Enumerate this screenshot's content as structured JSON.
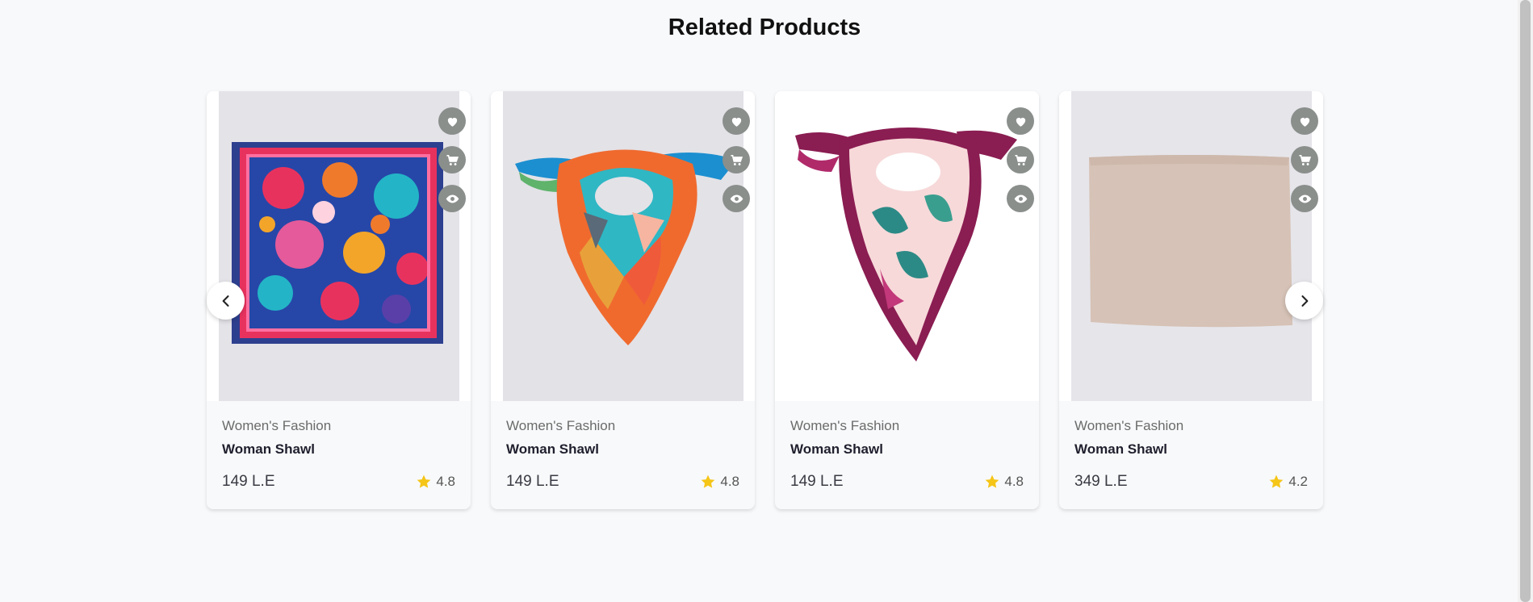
{
  "section": {
    "title": "Related Products"
  },
  "products": [
    {
      "category": "Women's Fashion",
      "name": "Woman Shawl",
      "price": "149 L.E",
      "rating": "4.8"
    },
    {
      "category": "Women's Fashion",
      "name": "Woman Shawl",
      "price": "149 L.E",
      "rating": "4.8"
    },
    {
      "category": "Women's Fashion",
      "name": "Woman Shawl",
      "price": "149 L.E",
      "rating": "4.8"
    },
    {
      "category": "Women's Fashion",
      "name": "Woman Shawl",
      "price": "349 L.E",
      "rating": "4.2"
    }
  ],
  "icons": {
    "wishlist": "heart-icon",
    "cart": "cart-icon",
    "quick_view": "eye-icon",
    "rating": "star-icon",
    "prev": "chevron-left-icon",
    "next": "chevron-right-icon"
  },
  "colors": {
    "action_button": "#8a8f8c",
    "star": "#f5c518",
    "background": "#f8f9fb"
  }
}
